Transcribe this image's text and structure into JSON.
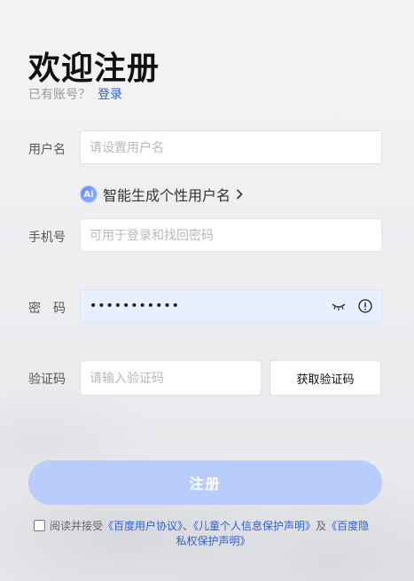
{
  "title": "欢迎注册",
  "login": {
    "prompt": "已有账号？",
    "link": "登录"
  },
  "username": {
    "label": "用户名",
    "placeholder": "请设置用户名"
  },
  "ai_suggest": {
    "badge": "Ai",
    "text": "智能生成个性用户名"
  },
  "phone": {
    "label": "手机号",
    "placeholder": "可用于登录和找回密码"
  },
  "password": {
    "label": "密　码",
    "value": "•••••••••••"
  },
  "code": {
    "label": "验证码",
    "placeholder": "请输入验证码",
    "button": "获取验证码"
  },
  "submit": {
    "label": "注册"
  },
  "agreement": {
    "prefix": "阅读并接受",
    "link1": "《百度用户协议》",
    "sep1": "、",
    "link2": "《儿童个人信息保护声明》",
    "sep2": "及",
    "link3a": "《百度隐",
    "link3b": "私权保护声明》"
  },
  "colors": {
    "accent": "#2f5fd0",
    "submit_bg": "#b8cdfb",
    "password_bg": "#e8f0fe"
  }
}
